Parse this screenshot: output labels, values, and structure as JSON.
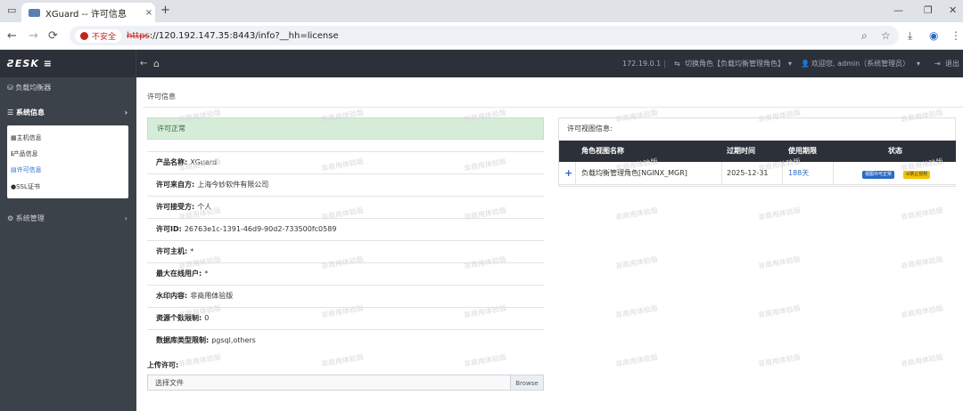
{
  "browser": {
    "tab_title": "XGuard -- 许可信息",
    "tab_close": "×",
    "new_tab": "+",
    "insecure_label": "不安全",
    "url_scheme": "https",
    "url_rest": "://120.192.147.35:8443/info?__hh=license",
    "nav": {
      "back": "←",
      "forward": "→",
      "reload": "⟳"
    },
    "window": {
      "minimize": "—",
      "restore": "❐",
      "close": "✕",
      "dropdown": "⌄"
    }
  },
  "header": {
    "ip": "172.19.0.1",
    "switch_role": "切换角色【负载均衡管理角色】",
    "welcome": "欢迎您, admin（系统管理员）",
    "logout": "退出",
    "back_icon": "←",
    "home_icon": "⌂"
  },
  "sidebar": {
    "load_balancer": "负载均衡器",
    "system_info": "系统信息",
    "system_mgmt": "系统管理",
    "sub": [
      "主机信息",
      "产品信息",
      "许可信息",
      "SSL证书"
    ]
  },
  "breadcrumb": "许可信息",
  "alert": "许可正常",
  "fields": [
    {
      "label": "产品名称:",
      "value": "XGuard"
    },
    {
      "label": "许可来自方:",
      "value": "上海今妙软件有限公司"
    },
    {
      "label": "许可接受方:",
      "value": "个人"
    },
    {
      "label": "许可ID:",
      "value": "26763e1c-1391-46d9-90d2-733500fc0589"
    },
    {
      "label": "许可主机:",
      "value": "*"
    },
    {
      "label": "最大在线用户:",
      "value": "*"
    },
    {
      "label": "水印内容:",
      "value": "非商用体验版"
    },
    {
      "label": "资源个数限制:",
      "value": "0"
    },
    {
      "label": "数据库类型限制:",
      "value": "pgsql,others"
    }
  ],
  "upload": {
    "label": "上传许可:",
    "placeholder": "选择文件",
    "browse": "Browse"
  },
  "view_panel": {
    "title": "许可视图信息:",
    "headers": [
      "角色视图名称",
      "过期时间",
      "使用期限",
      "状态"
    ],
    "row": {
      "expand": "+",
      "name": "负载均衡管理角色[NGINX_MGR]",
      "expire": "2025-12-31",
      "period": "188天",
      "badge1": "视图许可正常",
      "badge2": "⊘禁止授权"
    }
  },
  "watermark": "非商用体验版",
  "colors": {
    "accent": "#2a6bc3",
    "header": "#2c3038",
    "sidebar": "#3c424a",
    "alert_bg": "#d6ecd9"
  }
}
